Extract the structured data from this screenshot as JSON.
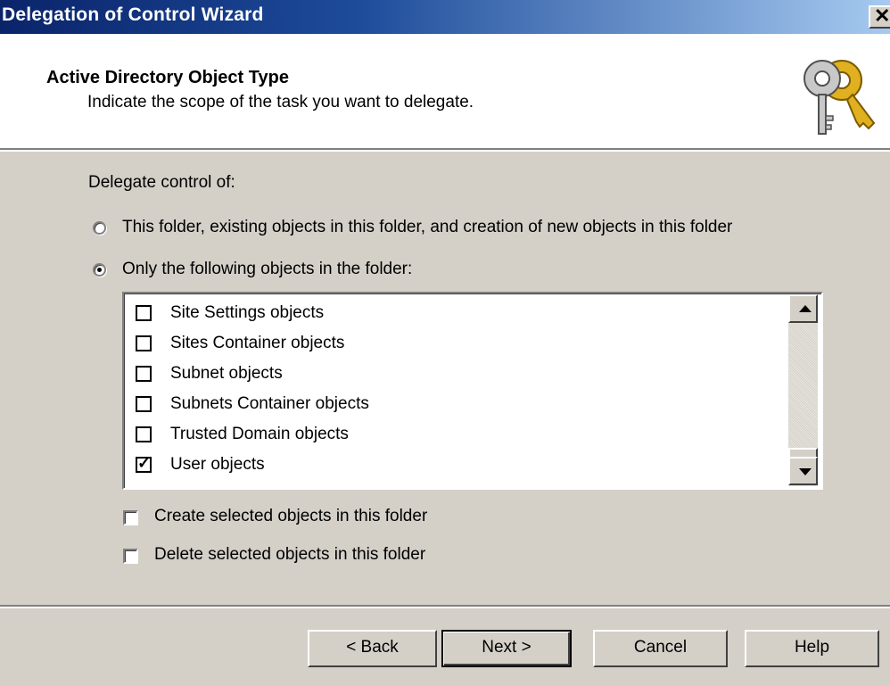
{
  "window": {
    "title": "Delegation of Control Wizard"
  },
  "header": {
    "heading": "Active Directory Object Type",
    "subheading": "Indicate the scope of the task you want to delegate.",
    "icon": "keys-icon"
  },
  "body": {
    "delegate_label": "Delegate control of:",
    "radio_options": [
      {
        "label": "This folder, existing objects in this folder, and creation of new objects in this folder",
        "selected": false
      },
      {
        "label": "Only the following objects in the folder:",
        "selected": true
      }
    ],
    "object_list": [
      {
        "label": "Site Settings objects",
        "checked": false
      },
      {
        "label": "Sites Container objects",
        "checked": false
      },
      {
        "label": "Subnet objects",
        "checked": false
      },
      {
        "label": "Subnets Container objects",
        "checked": false
      },
      {
        "label": "Trusted Domain objects",
        "checked": false
      },
      {
        "label": "User objects",
        "checked": true
      }
    ],
    "create_label": "Create selected objects in this folder",
    "delete_label": "Delete selected objects in this folder"
  },
  "buttons": {
    "back": "< Back",
    "next": "Next >",
    "cancel": "Cancel",
    "help": "Help"
  }
}
